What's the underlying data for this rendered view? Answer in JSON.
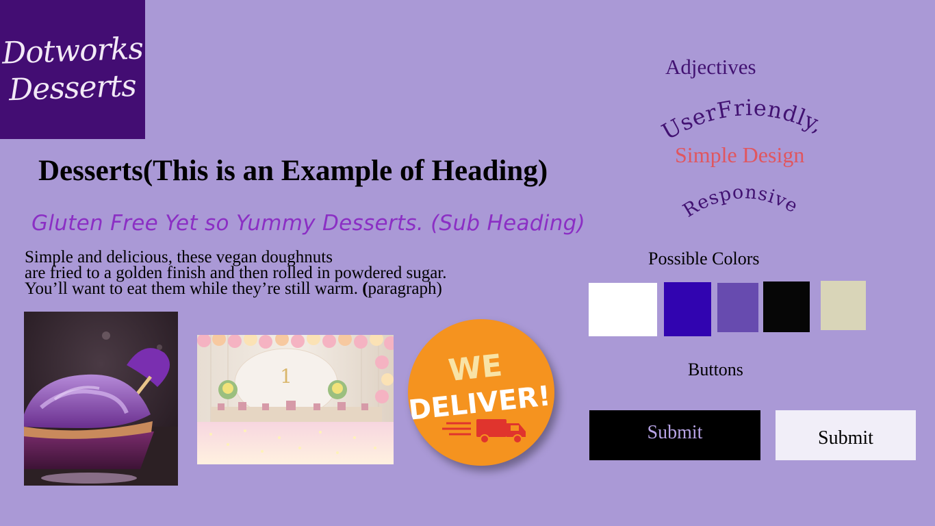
{
  "logo": {
    "line1": "Dotworks",
    "line2": "Desserts"
  },
  "heading": "Desserts(This is an Example of Heading)",
  "subheading": "Gluten Free Yet so Yummy Desserts. (Sub Heading)",
  "paragraph": {
    "line1": "Simple and delicious, these vegan doughnuts",
    "line2": "are fried to a golden finish and then rolled in powdered sugar.",
    "line3": "You’ll want to eat them while they’re still warm.",
    "paren_open": " (",
    "paren_rest": "paragraph)"
  },
  "images": {
    "badge_line1": "WE",
    "badge_line2": "DELIVER!"
  },
  "adjectives": {
    "title": "Adjectives",
    "item1": "UserFriendly,",
    "item2": "Simple Design",
    "item3": "Responsive"
  },
  "colors": {
    "title": "Possible Colors",
    "swatches": [
      "#ffffff",
      "#3104b0",
      "#674baf",
      "#060606",
      "#d9d5b8"
    ]
  },
  "buttons": {
    "title": "Buttons",
    "dark_label": "Submit",
    "light_label": "Submit"
  }
}
